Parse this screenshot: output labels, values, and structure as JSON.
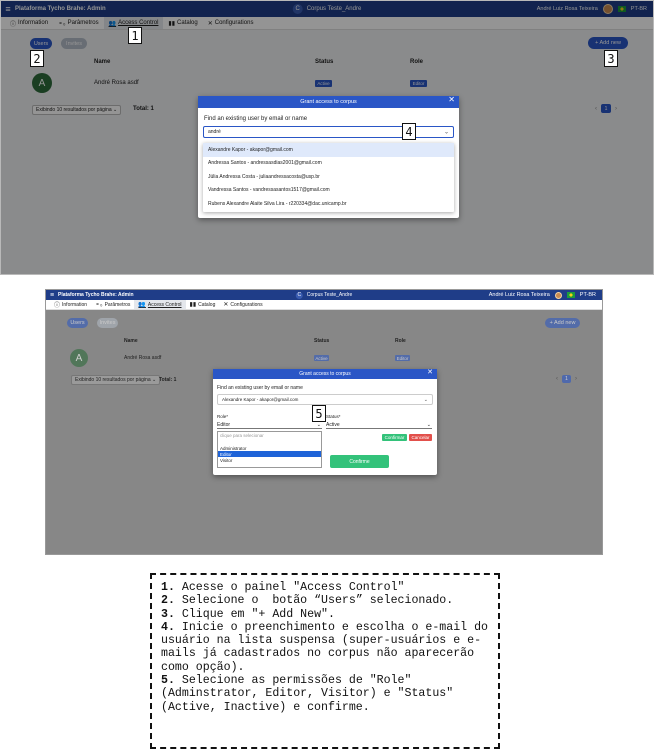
{
  "appbar": {
    "title": "Plataforma Tycho Brahe: Admin",
    "corpus_icon": "C",
    "corpus": "Corpus Teste_Andre",
    "user": "André Luiz Rosa Teixeira",
    "lang": "PT-BR"
  },
  "tabs": [
    {
      "icon": "ⓘ",
      "label": "Information"
    },
    {
      "icon": "⚬₀",
      "label": "Parâmetros"
    },
    {
      "icon": "👥",
      "label": "Access Control"
    },
    {
      "icon": "▮▮",
      "label": "Catalog"
    },
    {
      "icon": "✕",
      "label": "Configurations"
    }
  ],
  "pills": {
    "users": "Users",
    "invites": "Invites",
    "add_new": "+ Add new"
  },
  "table": {
    "headers": {
      "name": "Name",
      "status": "Status",
      "role": "Role"
    },
    "row": {
      "avatar_letter": "A",
      "name": "André Rosa asdf",
      "status": "Active",
      "role": "Editor"
    }
  },
  "pager": {
    "per_page": "Exibindo 10 resultados por página",
    "per_page_chev": "⌄",
    "total_label": "Total: 1",
    "prev": "‹",
    "page": "1",
    "next": "›"
  },
  "modal": {
    "title": "Grant access to corpus",
    "close": "✕",
    "field_label": "Find an existing user by email or name",
    "query": "andré",
    "chev": "⌄",
    "suggestions": [
      "Alexandre Kapor - akapor@gmail.com",
      "Andressa Santos - andressasdias2001@gmail.com",
      "Júlia Andressa Costa - juliaandressacosta@usp.br",
      "Vandressa Santos - vandressasantos1517@gmail.com",
      "Rubens Alexandre Alaite Silva Lira - r220334@dac.unicamp.br"
    ]
  },
  "modal2": {
    "selected_user": "Alexandre Kapor - akapor@gmail.com",
    "role_label": "Role*",
    "status_label": "Status*",
    "role_value": "Editor",
    "status_value": "Active",
    "role_options": [
      "clique para selecionar",
      "Administrator",
      "Editor",
      "Visitor"
    ],
    "small_confirm": "Confirmar",
    "small_cancel": "Cancelar",
    "confirm": "Confirme"
  },
  "callouts": [
    "1",
    "2",
    "3",
    "4",
    "5"
  ],
  "instructions": [
    {
      "num": "1.",
      "text": " Acesse o painel \"Access Control\""
    },
    {
      "num": "2.",
      "text": " Selecione o  botão “Users” selecionado."
    },
    {
      "num": "3.",
      "text": " Clique em \"+ Add New\"."
    },
    {
      "num": "4.",
      "text": " Inicie o preenchimento e escolha o e-mail do usuário na lista suspensa (super-usuários e e-mails já cadastrados no corpus não aparecerão como opção)."
    },
    {
      "num": "5.",
      "text": " Selecione as permissões de \"Role\" (Adminstrator, Editor, Visitor) e \"Status\" (Active, Inactive) e confirme."
    }
  ],
  "colors": {
    "primary": "#2a56c6",
    "appbar": "#1f3d88",
    "green": "#33c27a",
    "red": "#e2504b"
  }
}
